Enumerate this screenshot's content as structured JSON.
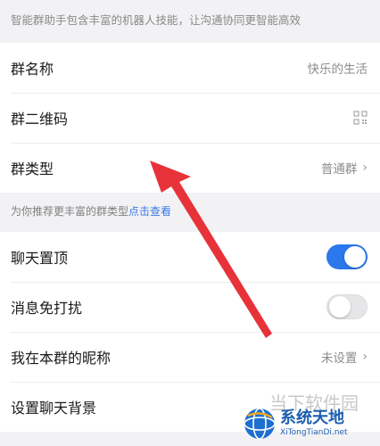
{
  "tip": "智能群助手包含丰富的机器人技能，让沟通协同更智能高效",
  "group1": {
    "name_label": "群名称",
    "name_value": "快乐的生活",
    "qr_label": "群二维码",
    "type_label": "群类型",
    "type_value": "普通群",
    "chevron": "›"
  },
  "hint": {
    "text": "为你推荐更丰富的群类型",
    "link": "点击查看"
  },
  "group2": {
    "pin_label": "聊天置顶",
    "pin_on": true,
    "mute_label": "消息免打扰",
    "mute_on": false,
    "nickname_label": "我在本群的昵称",
    "nickname_value": "未设置",
    "bg_label": "设置聊天背景"
  },
  "watermark": {
    "text": "当下软件园",
    "title": "系统天地",
    "sub": "XiTongTianDi.net"
  },
  "colors": {
    "accent": "#2a78ec",
    "arrow": "#e8323a",
    "link": "#3c7ae6"
  },
  "icons": {
    "qr": "qr-code-icon",
    "chevron": "chevron-right-icon",
    "globe": "globe-logo-icon"
  }
}
